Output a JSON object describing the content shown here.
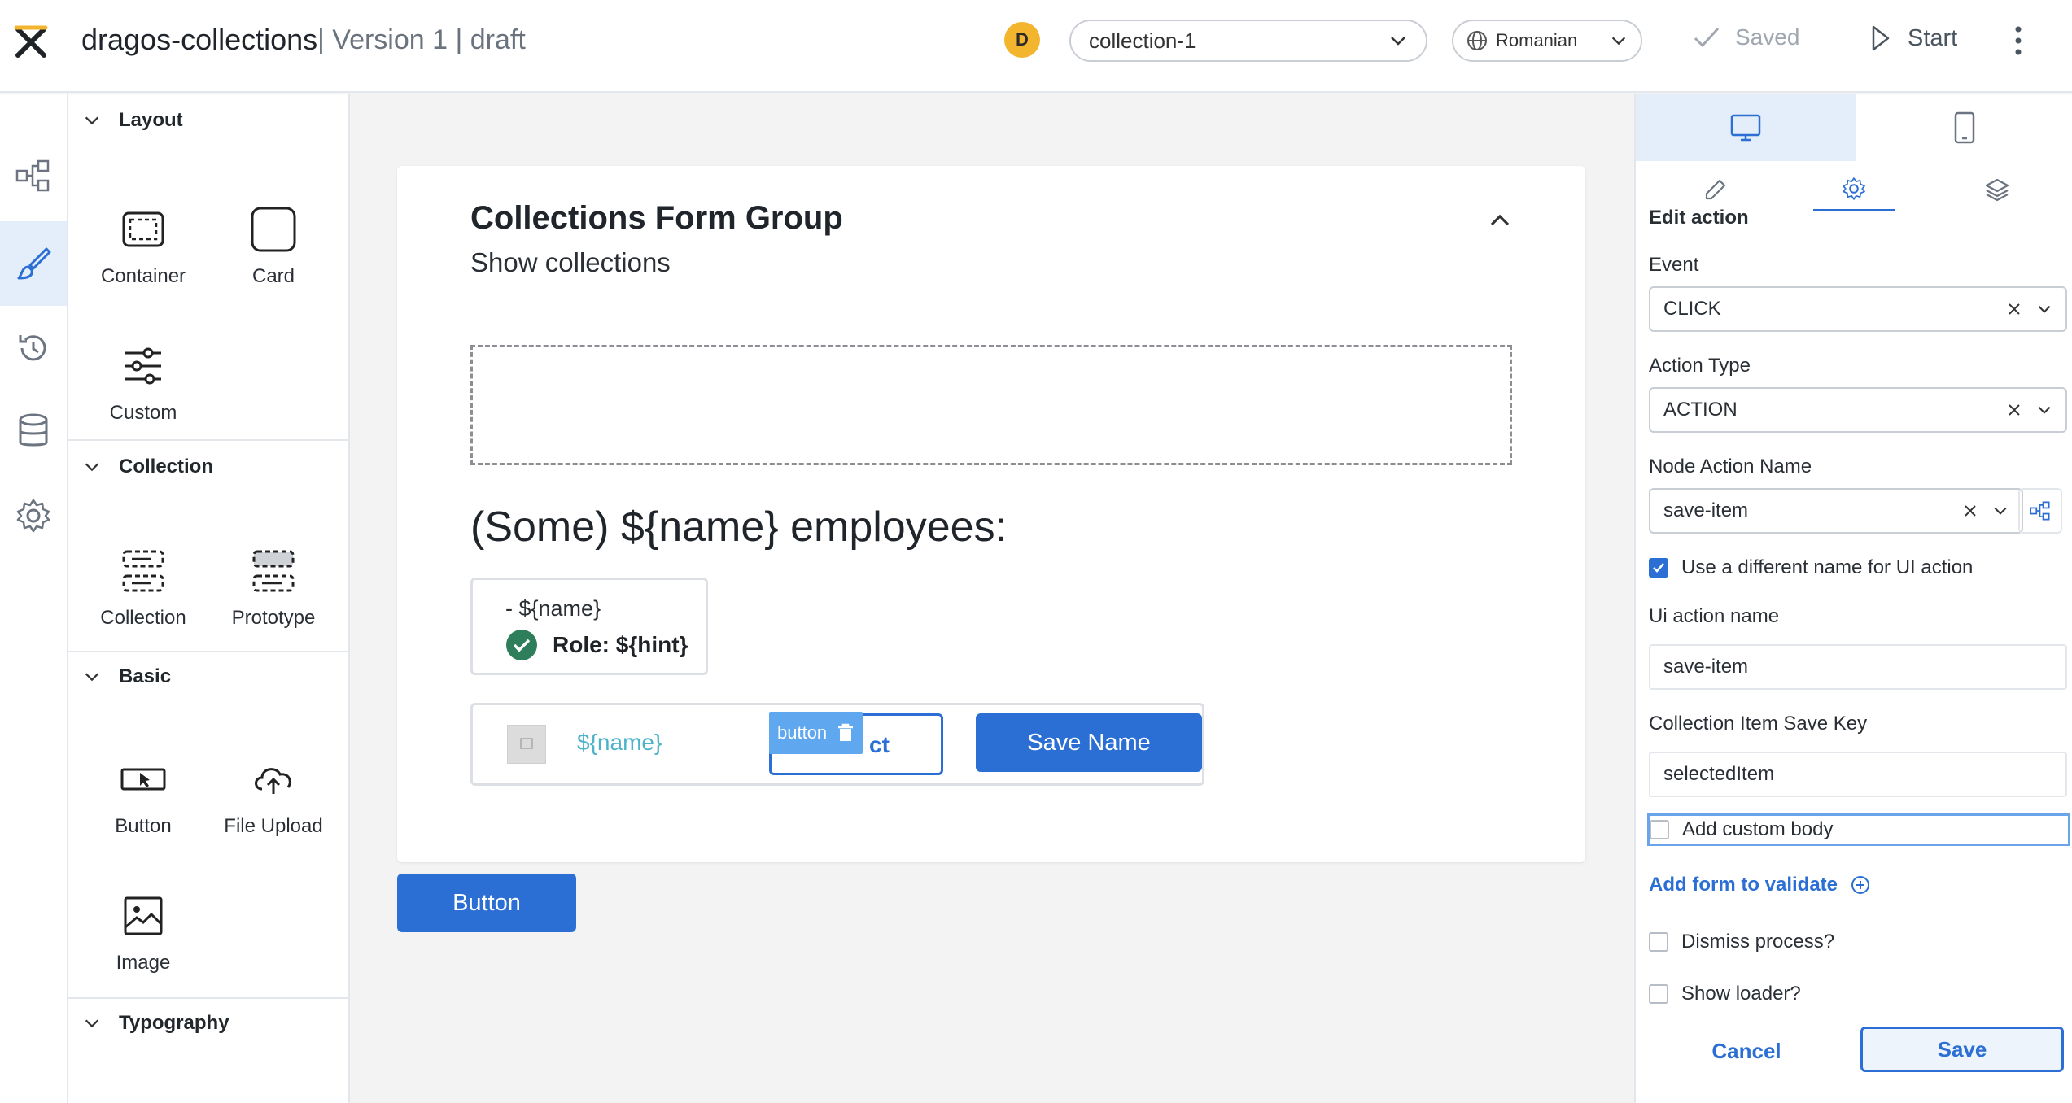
{
  "header": {
    "app_title": "dragos-collections",
    "version_label": "| Version 1 | draft",
    "avatar_initial": "D",
    "collection_select": "collection-1",
    "language_select": "Romanian",
    "saved_label": "Saved",
    "start_label": "Start"
  },
  "palette": {
    "sections": {
      "layout": "Layout",
      "collection": "Collection",
      "basic": "Basic",
      "typography": "Typography"
    },
    "items": {
      "container": "Container",
      "card": "Card",
      "custom": "Custom",
      "collection": "Collection",
      "prototype": "Prototype",
      "button": "Button",
      "file_upload": "File Upload",
      "image": "Image"
    }
  },
  "canvas": {
    "group_title": "Collections Form Group",
    "group_subtitle": "Show collections",
    "employees_heading": "(Some) ${name} employees:",
    "prototype_name": "- ${name}",
    "prototype_role": "Role: ${hint}",
    "row_name": "${name}",
    "select_button_visible_text": "ct",
    "button_tag": "button",
    "save_name_button": "Save Name",
    "standalone_button": "Button"
  },
  "properties": {
    "section_title": "Edit action",
    "event_label": "Event",
    "event_value": "CLICK",
    "action_type_label": "Action Type",
    "action_type_value": "ACTION",
    "node_action_label": "Node Action Name",
    "node_action_value": "save-item",
    "use_different_name_label": "Use a different name for UI action",
    "use_different_name_checked": true,
    "ui_action_label": "Ui action name",
    "ui_action_value": "save-item",
    "save_key_label": "Collection Item Save Key",
    "save_key_value": "selectedItem",
    "add_custom_body_label": "Add custom body",
    "add_custom_body_checked": false,
    "add_form_link": "Add form to validate",
    "dismiss_process_label": "Dismiss process?",
    "dismiss_process_checked": false,
    "show_loader_label": "Show loader?",
    "show_loader_checked": false,
    "cancel_button": "Cancel",
    "save_button": "Save"
  },
  "colors": {
    "accent": "#2c6fd4",
    "avatar": "#f3b52e",
    "success": "#2e7d5b",
    "template_text": "#4db3c9"
  }
}
